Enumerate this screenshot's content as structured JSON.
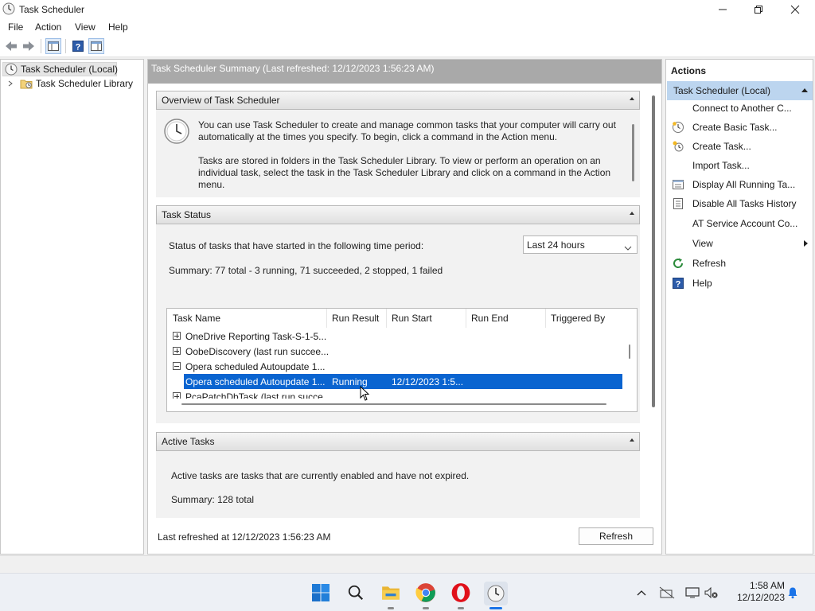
{
  "window": {
    "title": "Task Scheduler",
    "controls": [
      "minimize",
      "maximize",
      "close"
    ]
  },
  "menu": [
    "File",
    "Action",
    "View",
    "Help"
  ],
  "toolbar": {
    "icons": [
      "back-arrow-icon",
      "forward-arrow-icon",
      "show-hide-console-tree-icon",
      "help-icon",
      "show-hide-action-pane-icon"
    ]
  },
  "tree": {
    "items": [
      {
        "label": "Task Scheduler (Local)",
        "selected": true
      },
      {
        "label": "Task Scheduler Library",
        "selected": false
      }
    ]
  },
  "center": {
    "header": "Task Scheduler Summary (Last refreshed: 12/12/2023 1:56:23 AM)",
    "overview": {
      "title": "Overview of Task Scheduler",
      "para1": "You can use Task Scheduler to create and manage common tasks that your computer will carry out automatically at the times you specify. To begin, click a command in the Action menu.",
      "para2": "Tasks are stored in folders in the Task Scheduler Library. To view or perform an operation on an individual task, select the task in the Task Scheduler Library and click on a command in the Action menu."
    },
    "task_status": {
      "title": "Task Status",
      "period_label": "Status of tasks that have started in the following time period:",
      "period_value": "Last 24 hours",
      "summary": "Summary: 77 total - 3 running, 71 succeeded, 2 stopped, 1 failed",
      "columns": [
        "Task Name",
        "Run Result",
        "Run Start",
        "Run End",
        "Triggered By"
      ],
      "rows": [
        {
          "name": "OneDrive Reporting Task-S-1-5...",
          "result": "",
          "start": "",
          "expander": "plus",
          "indent": 0,
          "selected": false
        },
        {
          "name": "OobeDiscovery (last run succee...",
          "result": "",
          "start": "",
          "expander": "plus",
          "indent": 0,
          "selected": false
        },
        {
          "name": "Opera scheduled Autoupdate 1...",
          "result": "",
          "start": "",
          "expander": "minus",
          "indent": 0,
          "selected": false
        },
        {
          "name": "Opera scheduled Autoupdate 1...",
          "result": "Running",
          "start": "12/12/2023 1:5...",
          "expander": "none",
          "indent": 1,
          "selected": true
        },
        {
          "name": "PcaPatchDbTask (last run succe...",
          "result": "",
          "start": "",
          "expander": "plus",
          "indent": 0,
          "selected": false
        }
      ]
    },
    "active_tasks": {
      "title": "Active Tasks",
      "description": "Active tasks are tasks that are currently enabled and have not expired.",
      "summary": "Summary: 128 total"
    },
    "footer": {
      "last_refreshed": "Last refreshed at 12/12/2023 1:56:23 AM",
      "refresh_button": "Refresh"
    }
  },
  "actions": {
    "title": "Actions",
    "group": "Task Scheduler (Local)",
    "items": [
      {
        "label": "Connect to Another C...",
        "icon": ""
      },
      {
        "label": "Create Basic Task...",
        "icon": "create-basic-task-icon"
      },
      {
        "label": "Create Task...",
        "icon": "create-task-icon"
      },
      {
        "label": "Import Task...",
        "icon": ""
      },
      {
        "label": "Display All Running Ta...",
        "icon": "running-tasks-icon"
      },
      {
        "label": "Disable All Tasks History",
        "icon": "history-icon"
      },
      {
        "label": "AT Service Account Co...",
        "icon": ""
      },
      {
        "label": "View",
        "icon": "",
        "submenu": true
      },
      {
        "label": "Refresh",
        "icon": "refresh-icon"
      },
      {
        "label": "Help",
        "icon": "help-icon"
      }
    ]
  },
  "taskbar": {
    "apps": [
      "start-icon",
      "search-icon",
      "file-explorer-icon",
      "chrome-icon",
      "opera-icon",
      "task-scheduler-icon"
    ],
    "tray": [
      "chevron-up-icon",
      "network-off-icon",
      "display-icon",
      "volume-mute-icon",
      "notification-bell-icon"
    ],
    "time": "1:58 AM",
    "date": "12/12/2023"
  },
  "colors": {
    "selection": "#0a64d0",
    "actions_group": "#bcd5ef",
    "center_header": "#a9a9a9"
  }
}
